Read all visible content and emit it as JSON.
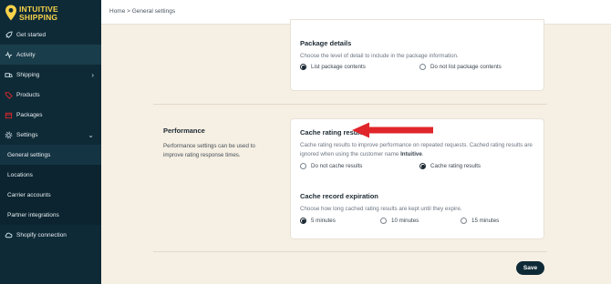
{
  "brand": {
    "line1": "INTUITIVE",
    "line2": "SHIPPING",
    "accent": "#f7d24a"
  },
  "sidebar": {
    "items": [
      {
        "label": "Get started",
        "icon": "rocket-icon"
      },
      {
        "label": "Activity",
        "icon": "activity-icon"
      },
      {
        "label": "Shipping",
        "icon": "truck-icon",
        "chevron": "›"
      },
      {
        "label": "Products",
        "icon": "tag-icon"
      },
      {
        "label": "Packages",
        "icon": "box-icon"
      },
      {
        "label": "Settings",
        "icon": "gear-icon",
        "chevron": "⌄"
      }
    ],
    "sub_items": [
      {
        "label": "General settings"
      },
      {
        "label": "Locations"
      },
      {
        "label": "Carrier accounts"
      },
      {
        "label": "Partner integrations"
      }
    ],
    "bottom_item": {
      "label": "Shopify connection",
      "icon": "cloud-icon"
    }
  },
  "breadcrumb": "Home > General settings",
  "package_details": {
    "title": "Package details",
    "description": "Choose the level of detail to include in the package information.",
    "options": [
      "List package contents",
      "Do not list package contents"
    ],
    "selected": "List package contents"
  },
  "performance": {
    "title": "Performance",
    "description": "Performance settings can be used to improve rating response times."
  },
  "cache_rating": {
    "title": "Cache rating results",
    "description_part1": "Cache rating results to improve performance on repeated requests. Cached rating results are ignored when using the customer name ",
    "description_bold": "Intuitive",
    "description_end": ".",
    "options": [
      "Do not cache results",
      "Cache rating results"
    ],
    "selected": "Cache rating results"
  },
  "cache_expiration": {
    "title": "Cache record expiration",
    "description": "Choose how long cached rating results are kept until they expire.",
    "options": [
      "5 minutes",
      "10 minutes",
      "15 minutes"
    ],
    "selected": "5 minutes"
  },
  "save_label": "Save",
  "colors": {
    "sidebar": "#0e2a37",
    "background": "#f6efe3",
    "arrow": "#e0262b"
  }
}
